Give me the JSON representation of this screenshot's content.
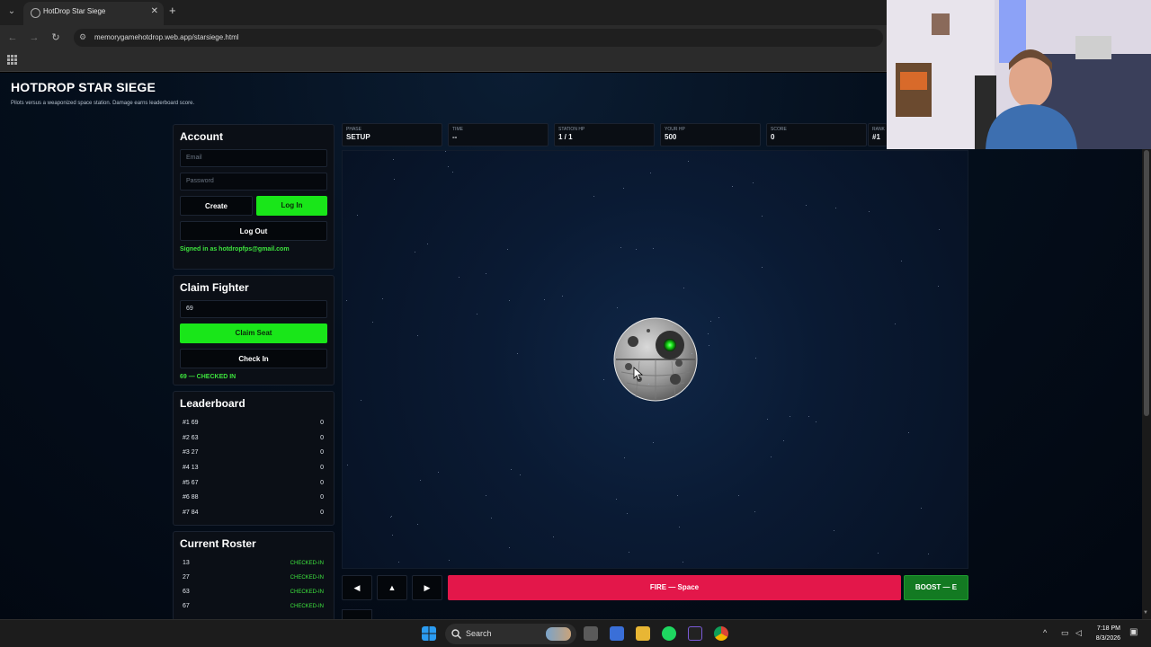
{
  "browser": {
    "tab_title": "HotDrop Star Siege",
    "close_glyph": "✕",
    "new_tab_glyph": "+",
    "url": "memorygamehotdrop.web.app/starsiege.html"
  },
  "header": {
    "title": "HOTDROP STAR SIEGE",
    "subtitle": "Pilots versus a weaponized space station. Damage earns leaderboard score."
  },
  "account": {
    "heading": "Account",
    "email_placeholder": "Email",
    "password_placeholder": "Password",
    "create_label": "Create",
    "login_label": "Log In",
    "logout_label": "Log Out",
    "signed_in_text": "Signed in as hotdropfps@gmail.com"
  },
  "claim": {
    "heading": "Claim Fighter",
    "seat_value": "69",
    "claim_label": "Claim Seat",
    "checkin_label": "Check In",
    "status_text": "69 — CHECKED IN"
  },
  "leaderboard": {
    "heading": "Leaderboard",
    "rows": [
      {
        "name": "#1 69",
        "score": "0"
      },
      {
        "name": "#2 63",
        "score": "0"
      },
      {
        "name": "#3 27",
        "score": "0"
      },
      {
        "name": "#4 13",
        "score": "0"
      },
      {
        "name": "#5 67",
        "score": "0"
      },
      {
        "name": "#6 88",
        "score": "0"
      },
      {
        "name": "#7 84",
        "score": "0"
      }
    ]
  },
  "roster": {
    "heading": "Current Roster",
    "rows": [
      {
        "name": "13",
        "status": "CHECKED-IN"
      },
      {
        "name": "27",
        "status": "CHECKED-IN"
      },
      {
        "name": "63",
        "status": "CHECKED-IN"
      },
      {
        "name": "67",
        "status": "CHECKED-IN"
      }
    ]
  },
  "hud": {
    "phase_label": "PHASE",
    "phase_value": "SETUP",
    "time_label": "TIME",
    "time_value": "--",
    "station_label": "STATION HP",
    "station_value": "1 / 1",
    "yourhp_label": "YOUR HP",
    "yourhp_value": "500",
    "score_label": "SCORE",
    "score_value": "0",
    "rank_label": "RANK",
    "rank_value": "#1"
  },
  "controls": {
    "left_glyph": "◀",
    "up_glyph": "▲",
    "right_glyph": "▶",
    "fire_label": "FIRE — Space",
    "boost_label": "BOOST — E"
  },
  "taskbar": {
    "search_label": "Search",
    "time": "7:18 PM",
    "date": "8/3/2026"
  },
  "colors": {
    "accent_green": "#19e619",
    "fire_red": "#e3174a",
    "boost_green": "#137a22",
    "status_green": "#3de33d"
  },
  "icons": [
    "tab-list-icon",
    "site-icon",
    "back-icon",
    "forward-icon",
    "reload-icon",
    "site-info-icon",
    "apps-icon",
    "station-icon",
    "cursor-icon",
    "windows-start-icon",
    "search-icon",
    "file-explorer-icon",
    "spotify-icon",
    "chrome-icon"
  ]
}
